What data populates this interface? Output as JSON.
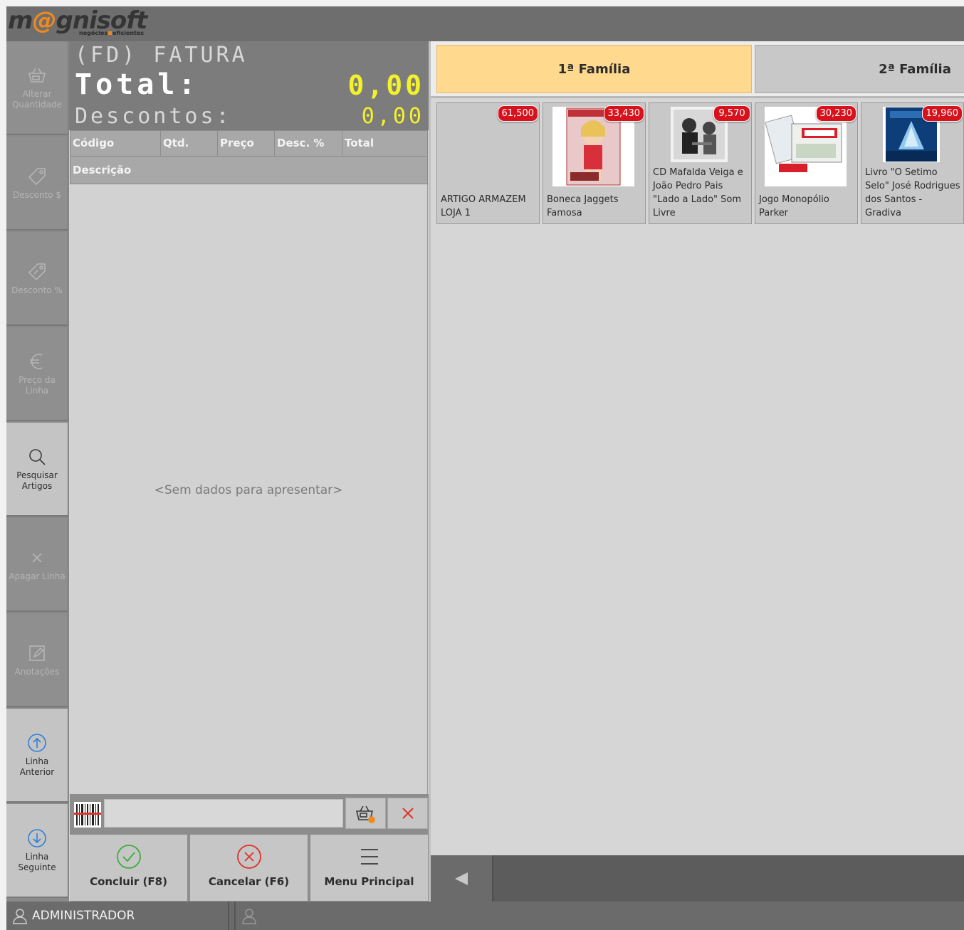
{
  "header": {
    "logo_main_left": "m",
    "logo_main_at": "@",
    "logo_main_right": "gnisoft",
    "logo_sub_left": "negócios",
    "logo_sub_right": "eficientes"
  },
  "sidebar": {
    "items": [
      {
        "label": "Alterar Quantidade",
        "icon": "basket-edit-icon",
        "enabled": false
      },
      {
        "label": "Desconto $",
        "icon": "tag-icon",
        "enabled": false
      },
      {
        "label": "Desconto %",
        "icon": "tag-percent-icon",
        "enabled": false
      },
      {
        "label": "Preço da Linha",
        "icon": "euro-icon",
        "enabled": false
      },
      {
        "label": "Pesquisar Artigos",
        "icon": "search-icon",
        "enabled": true
      },
      {
        "label": "Apagar Linha",
        "icon": "close-icon",
        "enabled": false
      },
      {
        "label": "Anotações",
        "icon": "note-edit-icon",
        "enabled": false
      },
      {
        "label": "Linha Anterior",
        "icon": "arrow-up-circle-icon",
        "enabled": true
      },
      {
        "label": "Linha Seguinte",
        "icon": "arrow-down-circle-icon",
        "enabled": true
      }
    ]
  },
  "document": {
    "type": "(FD) FATURA",
    "total_label": "Total:",
    "total_value": "0,00",
    "discounts_label": "Descontos:",
    "discounts_value": "0,00"
  },
  "grid": {
    "columns": [
      "Código",
      "Qtd.",
      "Preço",
      "Desc. %",
      "Total"
    ],
    "description_header": "Descrição",
    "empty_text": "<Sem dados para apresentar>"
  },
  "barcode": {
    "value": "",
    "placeholder": ""
  },
  "actions": {
    "conclude": "Concluir (F8)",
    "cancel": "Cancelar (F6)",
    "main_menu": "Menu Principal"
  },
  "families": [
    {
      "label": "1ª Família",
      "active": true
    },
    {
      "label": "2ª Família",
      "active": false
    }
  ],
  "products": [
    {
      "name": "ARTIGO ARMAZEM LOJA 1",
      "price": "61,500",
      "has_image": false
    },
    {
      "name": "Boneca Jaggets Famosa",
      "price": "33,430",
      "has_image": true
    },
    {
      "name": "CD Mafalda Veiga e João Pedro Pais \"Lado a Lado\" Som Livre",
      "price": "9,570",
      "has_image": true
    },
    {
      "name": "Jogo Monopólio Parker",
      "price": "30,230",
      "has_image": true
    },
    {
      "name": "Livro \"O Setimo Selo\" José Rodrigues dos Santos - Gradiva",
      "price": "19,960",
      "has_image": true
    }
  ],
  "statusbar": {
    "user": "ADMINISTRADOR"
  },
  "colors": {
    "active_family": "#fed98e",
    "price_badge": "#d8121c",
    "lcd_value": "#f3f22a",
    "logo_accent": "#f08a1c"
  }
}
